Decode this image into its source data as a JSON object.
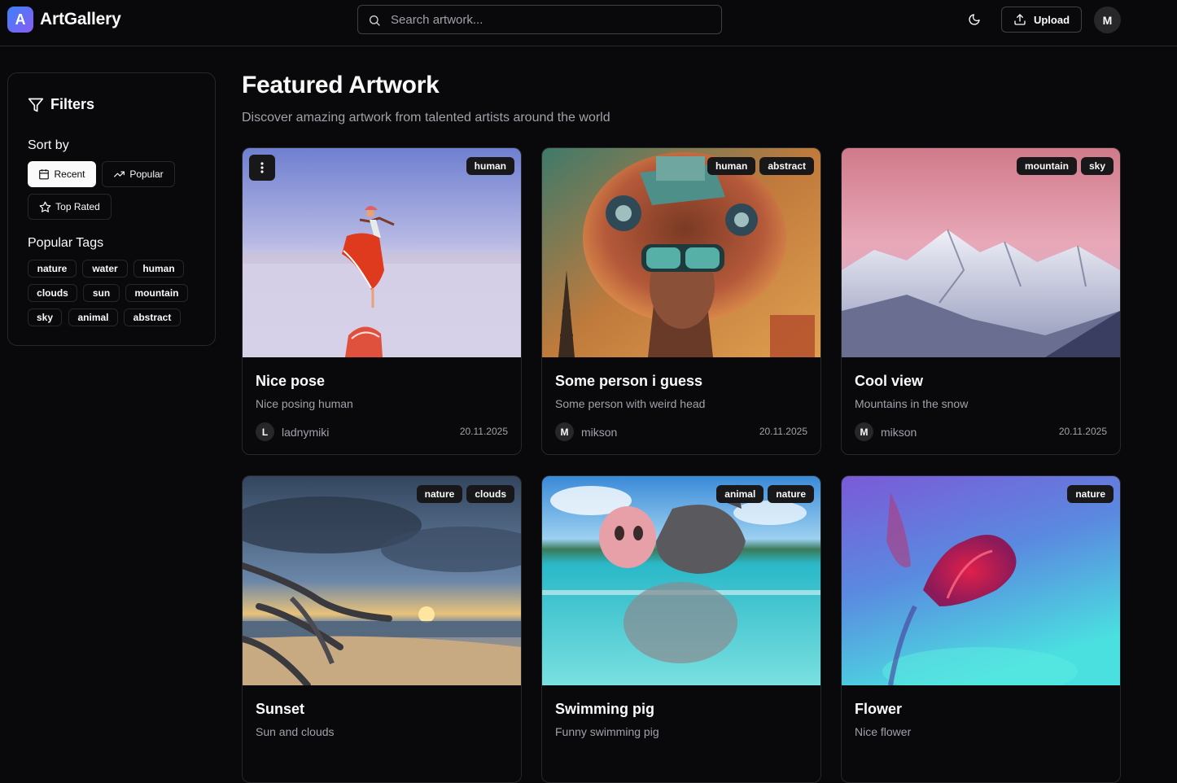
{
  "header": {
    "logo_letter": "A",
    "brand": "ArtGallery",
    "search_placeholder": "Search artwork...",
    "upload_label": "Upload",
    "user_initial": "M"
  },
  "sidebar": {
    "filters_title": "Filters",
    "sort_by_title": "Sort by",
    "sort_options": [
      {
        "label": "Recent",
        "icon": "calendar-icon",
        "active": true
      },
      {
        "label": "Popular",
        "icon": "trending-up-icon",
        "active": false
      },
      {
        "label": "Top Rated",
        "icon": "star-icon",
        "active": false
      }
    ],
    "popular_tags_title": "Popular Tags",
    "popular_tags": [
      "nature",
      "water",
      "human",
      "clouds",
      "sun",
      "mountain",
      "sky",
      "animal",
      "abstract"
    ]
  },
  "main": {
    "title": "Featured Artwork",
    "subtitle": "Discover amazing artwork from talented artists around the world"
  },
  "artworks": [
    {
      "title": "Nice pose",
      "description": "Nice posing human",
      "author": "ladnymiki",
      "author_initial": "L",
      "date": "20.11.2025",
      "tags": [
        "human"
      ],
      "image": "woman-on-salt-flat"
    },
    {
      "title": "Some person i guess",
      "description": "Some person with weird head",
      "author": "mikson",
      "author_initial": "M",
      "date": "20.11.2025",
      "tags": [
        "human",
        "abstract"
      ],
      "image": "surreal-person-vr-goggles"
    },
    {
      "title": "Cool view",
      "description": "Mountains in the snow",
      "author": "mikson",
      "author_initial": "M",
      "date": "20.11.2025",
      "tags": [
        "mountain",
        "sky"
      ],
      "image": "snowy-mountains"
    },
    {
      "title": "Sunset",
      "description": "Sun and clouds",
      "author": "",
      "author_initial": "",
      "date": "",
      "tags": [
        "nature",
        "clouds"
      ],
      "image": "beach-sunset"
    },
    {
      "title": "Swimming pig",
      "description": "Funny swimming pig",
      "author": "",
      "author_initial": "",
      "date": "",
      "tags": [
        "animal",
        "nature"
      ],
      "image": "pig-swimming"
    },
    {
      "title": "Flower",
      "description": "Nice flower",
      "author": "",
      "author_initial": "",
      "date": "",
      "tags": [
        "nature"
      ],
      "image": "red-flower"
    }
  ]
}
